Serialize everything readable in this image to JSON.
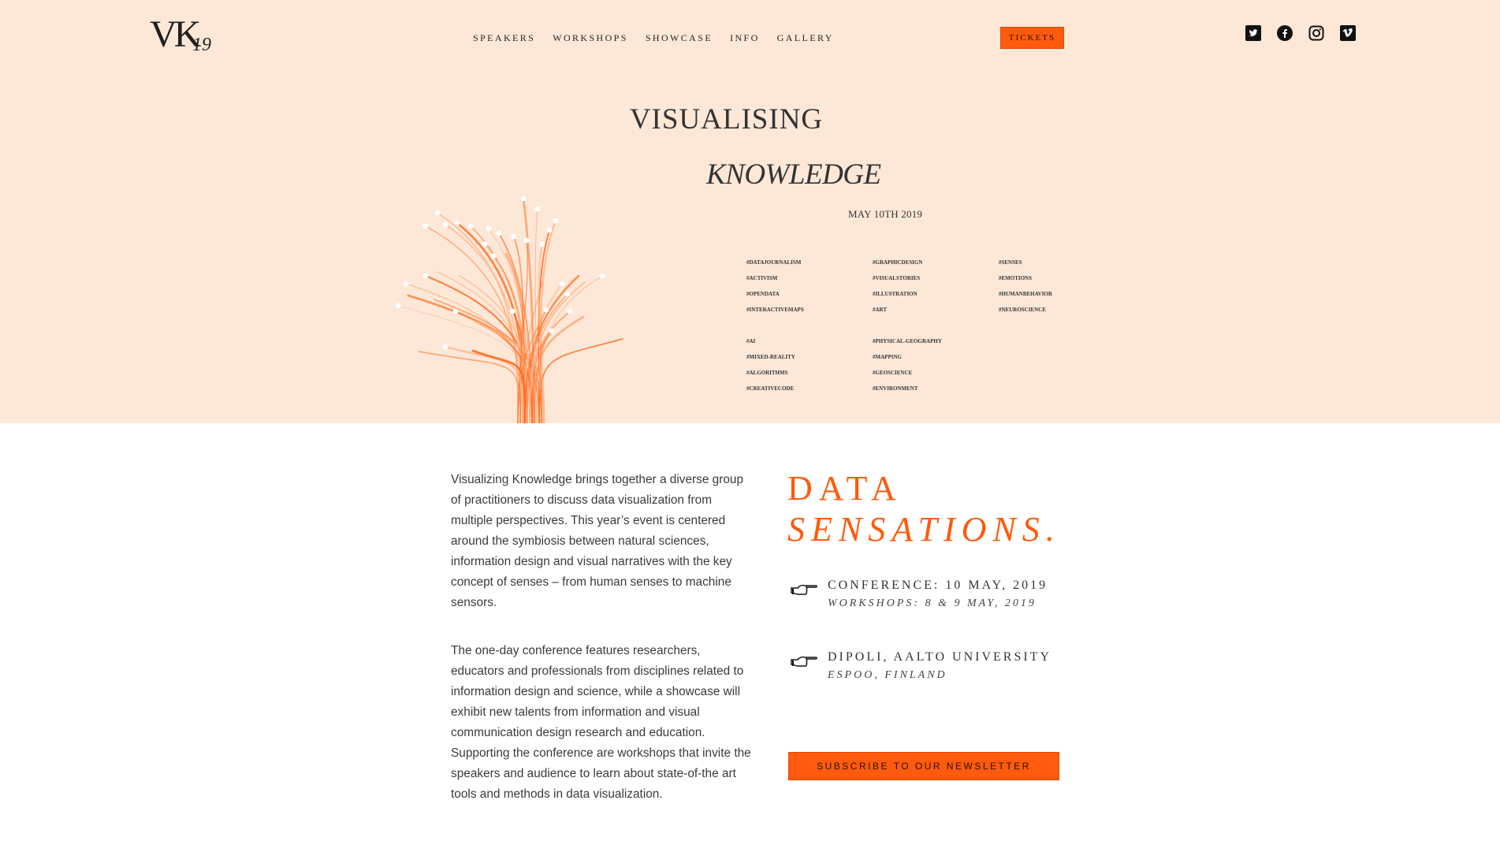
{
  "header": {
    "logo_text": "VK",
    "logo_year": "19",
    "nav": [
      "SPEAKERS",
      "WORKSHOPS",
      "SHOWCASE",
      "INFO",
      "GALLERY"
    ],
    "tickets_label": "TICKETS",
    "social_icons": [
      "twitter-icon",
      "facebook-icon",
      "instagram-icon",
      "vimeo-icon"
    ]
  },
  "hero": {
    "title_line1": "VISUALISING",
    "title_line2": "KNOWLEDGE",
    "date": "MAY 10TH 2019",
    "tags": {
      "col1a": [
        "#DATAJOURNALISM",
        "#ACTIVISM",
        "#OPENDATA",
        "#INTERACTIVEMAPS"
      ],
      "col2a": [
        "#GRAPHICDESIGN",
        "#VISUALSTORIES",
        "#ILLUSTRATION",
        "#ART"
      ],
      "col3a": [
        "#SENSES",
        "#EMOTIONS",
        "#HUMANBEHAVIOR",
        "#NEUROSCIENCE"
      ],
      "col1b": [
        "#AI",
        "#MIXED-REALITY",
        "#ALGORITHMS",
        "#CREATIVECODE"
      ],
      "col2b": [
        "#PHYSICAL-GEOGRAPHY",
        "#MAPPING",
        "#GEOSCIENCE",
        "#ENVIRONMENT"
      ]
    },
    "accent_color": "#ff5a0d",
    "background_color": "#fde8d8"
  },
  "main": {
    "intro_paragraphs": [
      "Visualizing Knowledge brings together a diverse group of practitioners to discuss data visualization from multiple perspectives. This year’s event is centered around the symbiosis between natural sciences, information design and visual narratives with the key concept of senses – from human senses to machine sensors.",
      "The one-day conference features researchers, educators and professionals from disciplines related to information design and science, while a showcase will exhibit new talents from information and visual communication design research and education. Supporting the conference are workshops that invite the speakers and audience to learn about state-of-the art tools and methods in data visualization."
    ],
    "heading_line1": "DATA",
    "heading_line2": "SENSATIONS.",
    "dates_line1": "CONFERENCE: 10 MAY, 2019",
    "dates_line2": "WORKSHOPS: 8 & 9 MAY, 2019",
    "venue_line1": "DIPOLI, AALTO UNIVERSITY",
    "venue_line2": "ESPOO, FINLAND",
    "subscribe_label": "SUBSCRIBE TO OUR NEWSLETTER"
  }
}
